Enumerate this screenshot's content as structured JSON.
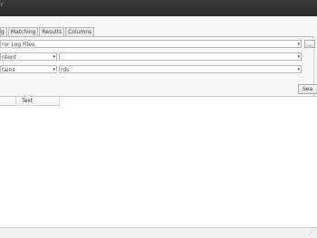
{
  "window": {
    "title": "r"
  },
  "tabs": [
    {
      "label": "g"
    },
    {
      "label": "Matching"
    },
    {
      "label": "Results"
    },
    {
      "label": "Columns"
    }
  ],
  "search": {
    "path_value": "ror Log Files",
    "path_arrow": "▾",
    "browse_label": "...",
    "field1_value": "ntent",
    "field1_arrow": "▾",
    "value1": "",
    "value1_arrow": "▾",
    "field2_value": "tains",
    "field2_arrow": "▾",
    "value2": "rds",
    "value2_arrow": "▾",
    "search_button_label": "Sea"
  },
  "results": {
    "columns": [
      "",
      "Text"
    ]
  },
  "statusbar": {
    "text": "",
    "grip_icon": "⋰"
  }
}
